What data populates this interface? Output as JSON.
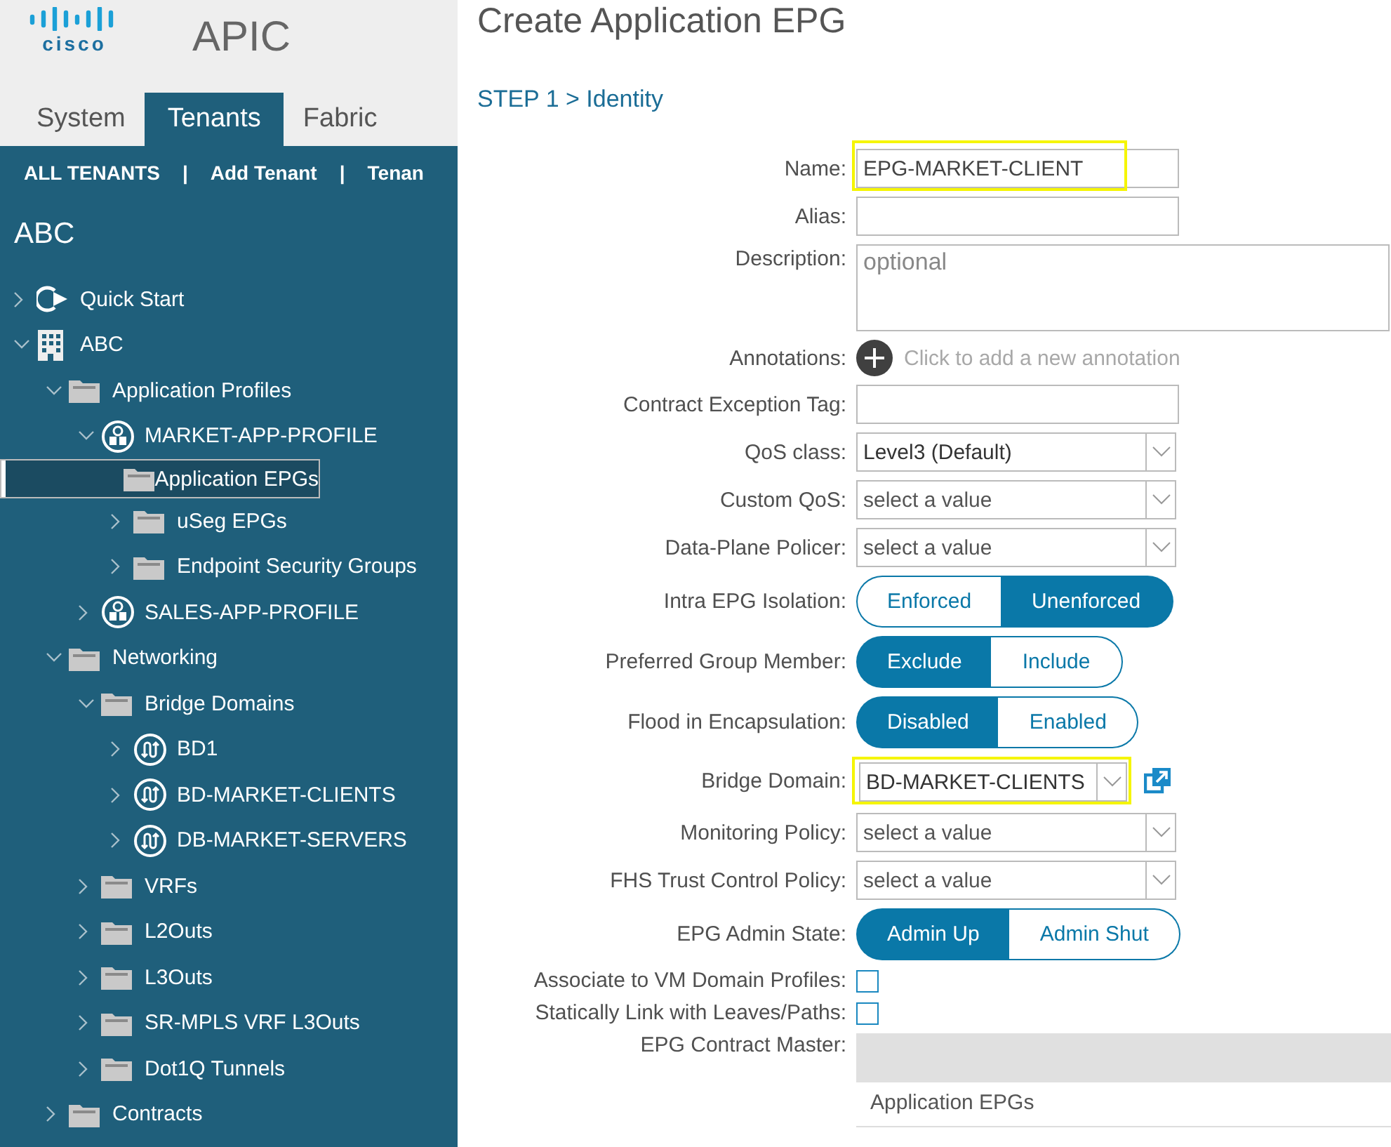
{
  "header": {
    "logo": "cisco",
    "product": "APIC"
  },
  "tabs": [
    {
      "label": "System",
      "selected": false
    },
    {
      "label": "Tenants",
      "selected": true
    },
    {
      "label": "Fabric",
      "selected": false
    }
  ],
  "subnav": [
    "ALL TENANTS",
    "|",
    "Add Tenant",
    "|",
    "Tenan"
  ],
  "sidebar": {
    "title": "ABC",
    "tree": [
      {
        "label": "Quick Start",
        "kind": "quickstart",
        "expanded": false,
        "selected": false
      },
      {
        "label": "ABC",
        "kind": "tenant",
        "expanded": true,
        "selected": false,
        "children": [
          {
            "label": "Application Profiles",
            "kind": "folder",
            "expanded": true,
            "selected": false,
            "children": [
              {
                "label": "MARKET-APP-PROFILE",
                "kind": "app-profile",
                "expanded": true,
                "selected": false,
                "children": [
                  {
                    "label": "Application EPGs",
                    "kind": "folder",
                    "selected": true
                  },
                  {
                    "label": "uSeg EPGs",
                    "kind": "folder",
                    "expanded": false,
                    "selected": false
                  },
                  {
                    "label": "Endpoint Security Groups",
                    "kind": "folder",
                    "expanded": false,
                    "selected": false
                  }
                ]
              },
              {
                "label": "SALES-APP-PROFILE",
                "kind": "app-profile",
                "expanded": false,
                "selected": false
              }
            ]
          },
          {
            "label": "Networking",
            "kind": "folder",
            "expanded": true,
            "selected": false,
            "children": [
              {
                "label": "Bridge Domains",
                "kind": "folder",
                "expanded": true,
                "selected": false,
                "children": [
                  {
                    "label": "BD1",
                    "kind": "bridge-domain",
                    "expanded": false,
                    "selected": false
                  },
                  {
                    "label": "BD-MARKET-CLIENTS",
                    "kind": "bridge-domain",
                    "expanded": false,
                    "selected": false
                  },
                  {
                    "label": "DB-MARKET-SERVERS",
                    "kind": "bridge-domain",
                    "expanded": false,
                    "selected": false
                  }
                ]
              },
              {
                "label": "VRFs",
                "kind": "folder",
                "expanded": false,
                "selected": false
              },
              {
                "label": "L2Outs",
                "kind": "folder",
                "expanded": false,
                "selected": false
              },
              {
                "label": "L3Outs",
                "kind": "folder",
                "expanded": false,
                "selected": false
              },
              {
                "label": "SR-MPLS VRF L3Outs",
                "kind": "folder",
                "expanded": false,
                "selected": false
              },
              {
                "label": "Dot1Q Tunnels",
                "kind": "folder",
                "expanded": false,
                "selected": false
              }
            ]
          },
          {
            "label": "Contracts",
            "kind": "folder",
            "expanded": false,
            "selected": false
          }
        ]
      }
    ]
  },
  "dialog": {
    "title": "Create Application EPG",
    "step": "STEP 1 > Identity"
  },
  "form": {
    "fields": [
      {
        "kind": "text",
        "label": "Name:",
        "value": "EPG-MARKET-CLIENT",
        "highlighted": true
      },
      {
        "kind": "text",
        "label": "Alias:"
      },
      {
        "kind": "textarea",
        "label": "Description:",
        "placeholder": "optional"
      },
      {
        "kind": "annotation",
        "label": "Annotations:",
        "hint": "Click to add a new annotation"
      },
      {
        "kind": "text",
        "label": "Contract Exception Tag:"
      },
      {
        "kind": "select",
        "label": "QoS class:",
        "value": "Level3 (Default)"
      },
      {
        "kind": "select",
        "label": "Custom QoS:",
        "placeholder": "select a value"
      },
      {
        "kind": "select",
        "label": "Data-Plane Policer:",
        "placeholder": "select a value"
      },
      {
        "kind": "toggle",
        "label": "Intra EPG Isolation:",
        "options": [
          {
            "label": "Enforced",
            "selected": false
          },
          {
            "label": "Unenforced",
            "selected": true
          }
        ]
      },
      {
        "kind": "toggle",
        "label": "Preferred Group Member:",
        "options": [
          {
            "label": "Exclude",
            "selected": true
          },
          {
            "label": "Include",
            "selected": false
          }
        ]
      },
      {
        "kind": "toggle",
        "label": "Flood in Encapsulation:",
        "options": [
          {
            "label": "Disabled",
            "selected": true
          },
          {
            "label": "Enabled",
            "selected": false
          }
        ]
      },
      {
        "kind": "select",
        "label": "Bridge Domain:",
        "value": "BD-MARKET-CLIENTS",
        "highlighted": true,
        "link": true
      },
      {
        "kind": "select",
        "label": "Monitoring Policy:",
        "placeholder": "select a value"
      },
      {
        "kind": "select",
        "label": "FHS Trust Control Policy:",
        "placeholder": "select a value"
      },
      {
        "kind": "toggle",
        "label": "EPG Admin State:",
        "options": [
          {
            "label": "Admin Up",
            "selected": true
          },
          {
            "label": "Admin Shut",
            "selected": false
          }
        ]
      },
      {
        "kind": "checkbox",
        "label": "Associate to VM Domain Profiles:",
        "checked": false
      },
      {
        "kind": "checkbox",
        "label": "Statically Link with Leaves/Paths:",
        "checked": false
      },
      {
        "kind": "table",
        "label": "EPG Contract Master:",
        "rows": [
          "Application EPGs"
        ]
      }
    ]
  }
}
